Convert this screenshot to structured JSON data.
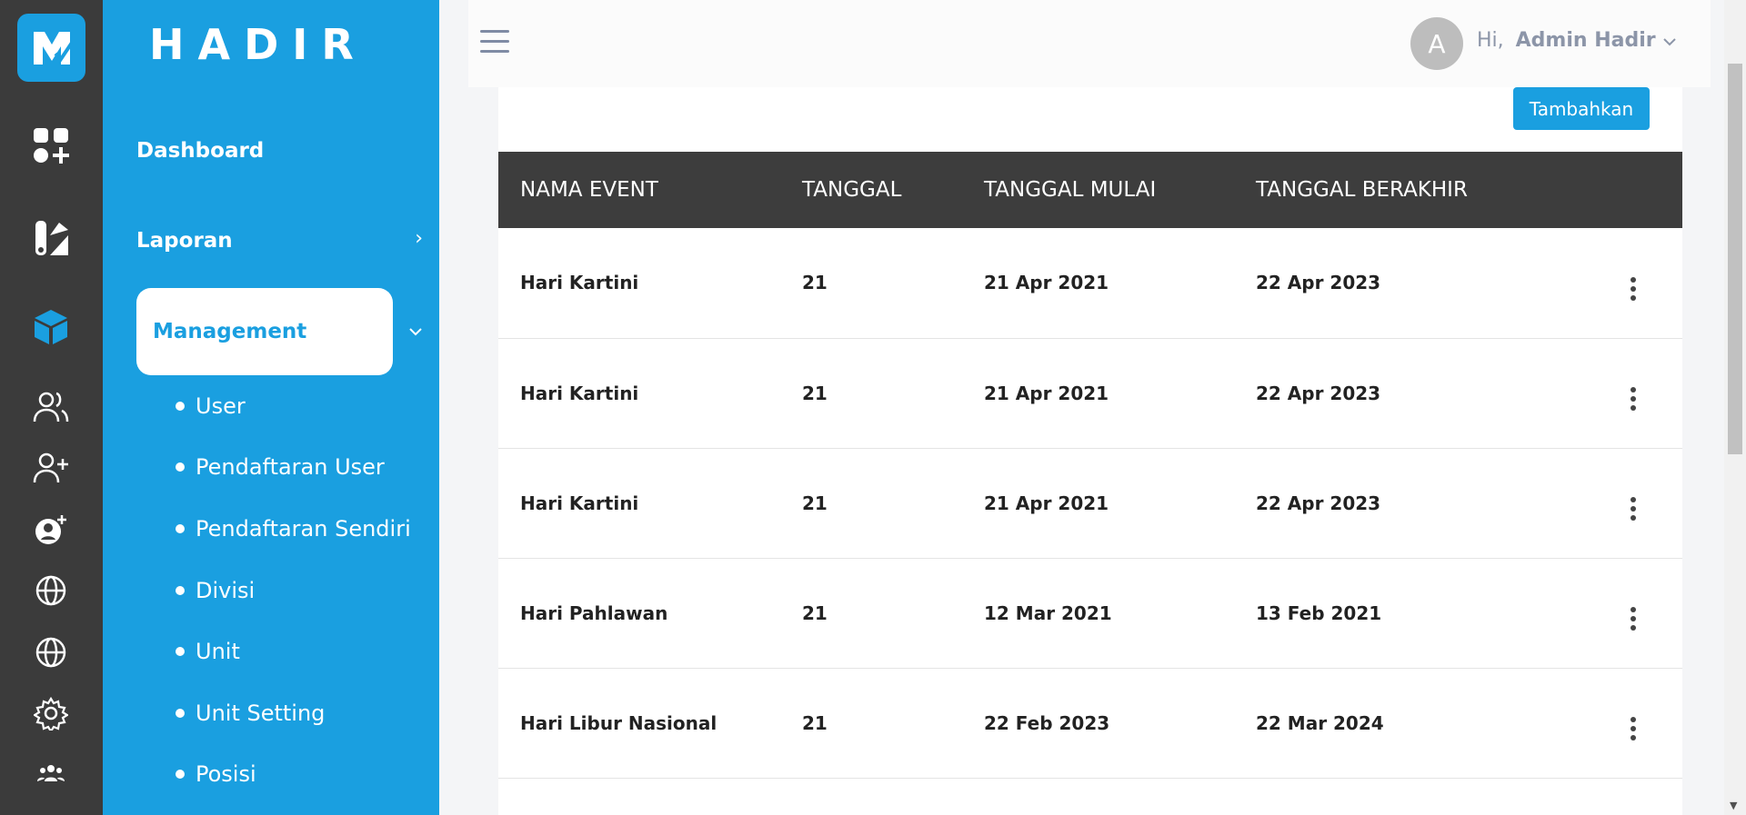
{
  "brand": {
    "name": "HADIR",
    "accent": "#1a9fe0",
    "rail_bg": "#3b3b3b"
  },
  "rail": {
    "icons": [
      "app-logo-icon",
      "dashboard-icon",
      "report-icon",
      "management-cube-icon",
      "users-icon",
      "user-add-icon",
      "user-plus-icon",
      "globe-icon",
      "globe-icon",
      "gear-icon",
      "group-icon"
    ]
  },
  "sidebar": {
    "dashboard": "Dashboard",
    "laporan": "Laporan",
    "management": "Management",
    "sub_items": [
      "User",
      "Pendaftaran User",
      "Pendaftaran Sendiri",
      "Divisi",
      "Unit",
      "Unit Setting",
      "Posisi"
    ]
  },
  "topbar": {
    "avatar_letter": "A",
    "greeting": "Hi,",
    "user_name": "Admin Hadir"
  },
  "main": {
    "add_button": "Tambahkan",
    "columns": [
      "NAMA EVENT",
      "TANGGAL",
      "TANGGAL MULAI",
      "TANGGAL BERAKHIR"
    ],
    "rows": [
      {
        "name": "Hari Kartini",
        "tanggal": "21",
        "mulai": "21 Apr 2021",
        "berakhir": "22 Apr 2023"
      },
      {
        "name": "Hari Kartini",
        "tanggal": "21",
        "mulai": "21 Apr 2021",
        "berakhir": "22 Apr 2023"
      },
      {
        "name": "Hari Kartini",
        "tanggal": "21",
        "mulai": "21 Apr 2021",
        "berakhir": "22 Apr 2023"
      },
      {
        "name": "Hari Pahlawan",
        "tanggal": "21",
        "mulai": "12 Mar 2021",
        "berakhir": "13 Feb 2021"
      },
      {
        "name": "Hari Libur Nasional",
        "tanggal": "21",
        "mulai": "22 Feb 2023",
        "berakhir": "22 Mar 2024"
      }
    ]
  }
}
